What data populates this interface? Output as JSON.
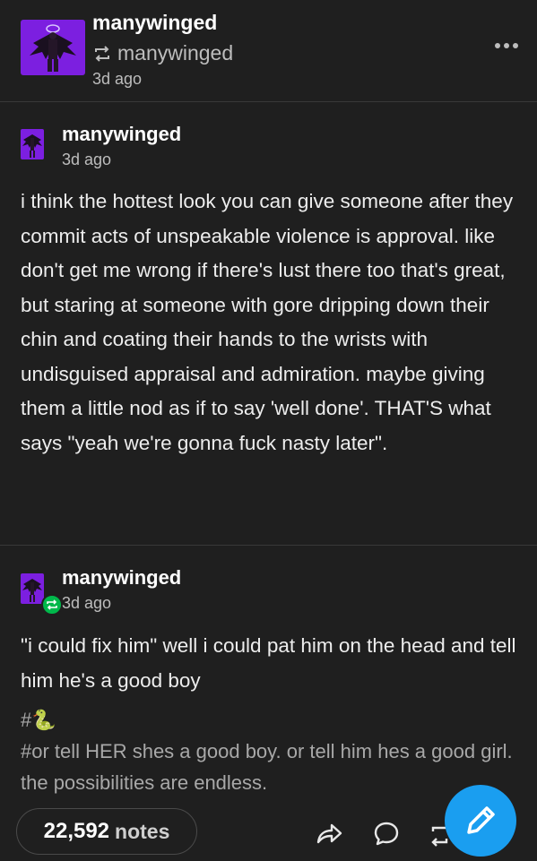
{
  "header": {
    "username": "manywinged",
    "reblogged_from": "manywinged",
    "time": "3d ago",
    "avatar_icon": "winged-figure-avatar-icon",
    "more_icon": "more-options-icon"
  },
  "posts": [
    {
      "username": "manywinged",
      "time": "3d ago",
      "body": "i think the hottest look you can give someone after they commit acts of unspeakable violence is approval. like don't get me wrong if there's lust there too that's great, but staring at someone with gore dripping down their chin and coating their hands to the wrists with undisguised appraisal and admiration. maybe giving them a little nod as if to say 'well done'. THAT'S what says \"yeah we're gonna fuck nasty later\"."
    },
    {
      "username": "manywinged",
      "time": "3d ago",
      "body": "\"i could fix him\" well i could pat him on the head and tell him he's a good boy",
      "tags": [
        "#🐍",
        "#or tell HER shes a good boy. or tell him hes a good girl. the possibilities are endless."
      ]
    }
  ],
  "footer": {
    "notes_count": "22,592",
    "notes_label": "notes",
    "icons": [
      "share-icon",
      "reply-icon",
      "reblog-icon",
      "compose-icon"
    ]
  },
  "colors": {
    "background": "#1f1f1f",
    "avatar_purple": "#7c1fe0",
    "reblog_green": "#00b84b",
    "fab_blue": "#1a9ef0"
  }
}
